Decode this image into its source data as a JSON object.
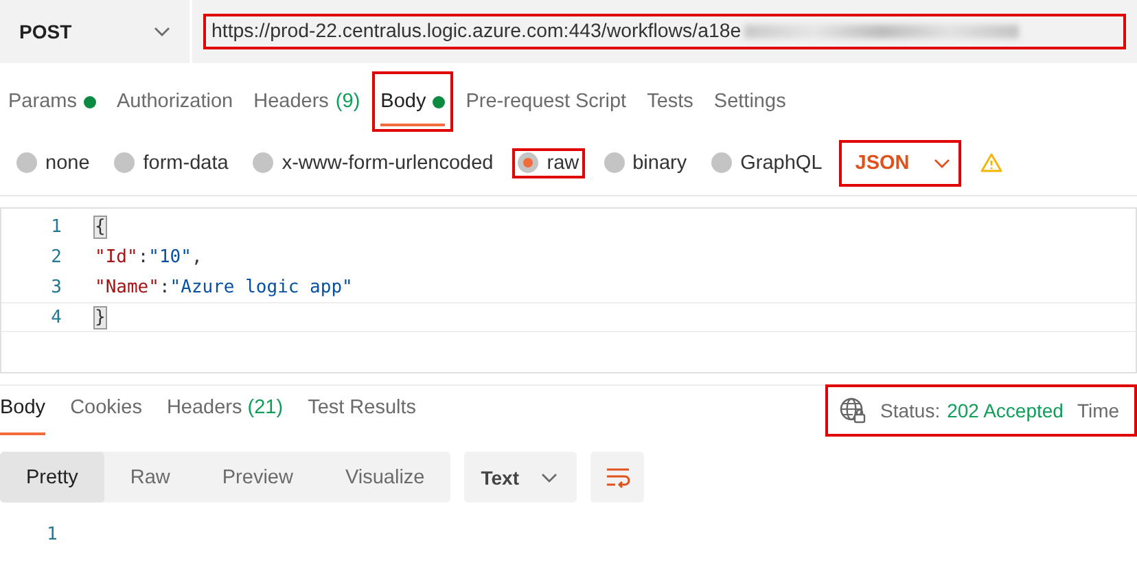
{
  "request": {
    "method": "POST",
    "url": "https://prod-22.centralus.logic.azure.com:443/workflows/a18e",
    "url_highlighted": true,
    "url_redacted": true
  },
  "request_tabs": [
    {
      "label": "Params",
      "dot": true,
      "selected": false,
      "highlighted": false
    },
    {
      "label": "Authorization",
      "dot": false,
      "selected": false,
      "highlighted": false
    },
    {
      "label": "Headers",
      "count": "(9)",
      "dot": false,
      "selected": false,
      "highlighted": false
    },
    {
      "label": "Body",
      "dot": true,
      "selected": true,
      "highlighted": true
    },
    {
      "label": "Pre-request Script",
      "dot": false,
      "selected": false,
      "highlighted": false
    },
    {
      "label": "Tests",
      "dot": false,
      "selected": false,
      "highlighted": false
    },
    {
      "label": "Settings",
      "dot": false,
      "selected": false,
      "highlighted": false
    }
  ],
  "body_types": [
    {
      "label": "none",
      "selected": false,
      "highlighted": false
    },
    {
      "label": "form-data",
      "selected": false,
      "highlighted": false
    },
    {
      "label": "x-www-form-urlencoded",
      "selected": false,
      "highlighted": false
    },
    {
      "label": "raw",
      "selected": true,
      "highlighted": true
    },
    {
      "label": "binary",
      "selected": false,
      "highlighted": false
    },
    {
      "label": "GraphQL",
      "selected": false,
      "highlighted": false
    }
  ],
  "raw_format": {
    "value": "JSON",
    "highlighted": true,
    "warning": true
  },
  "editor": {
    "lines": [
      {
        "number": "1",
        "tokens": [
          {
            "kind": "bracket",
            "text": "{"
          }
        ]
      },
      {
        "number": "2",
        "tokens": [
          {
            "kind": "key",
            "text": "\"Id\""
          },
          {
            "kind": "punct",
            "text": ":"
          },
          {
            "kind": "string",
            "text": "\"10\""
          },
          {
            "kind": "punct",
            "text": ","
          }
        ]
      },
      {
        "number": "3",
        "tokens": [
          {
            "kind": "key",
            "text": "\"Name\""
          },
          {
            "kind": "punct",
            "text": ":"
          },
          {
            "kind": "string",
            "text": "\"Azure logic app\""
          }
        ]
      },
      {
        "number": "4",
        "tokens": [
          {
            "kind": "bracket",
            "text": "}"
          }
        ]
      }
    ]
  },
  "response": {
    "tabs": [
      {
        "label": "Body",
        "selected": true
      },
      {
        "label": "Cookies",
        "selected": false
      },
      {
        "label": "Headers",
        "count": "(21)",
        "selected": false
      },
      {
        "label": "Test Results",
        "selected": false
      }
    ],
    "status": {
      "label": "Status:",
      "value": "202 Accepted",
      "next_label": "Time",
      "highlighted": true
    },
    "view_modes": [
      {
        "label": "Pretty",
        "selected": true
      },
      {
        "label": "Raw",
        "selected": false
      },
      {
        "label": "Preview",
        "selected": false
      },
      {
        "label": "Visualize",
        "selected": false
      }
    ],
    "format": "Text",
    "line_numbers": [
      "1"
    ]
  }
}
